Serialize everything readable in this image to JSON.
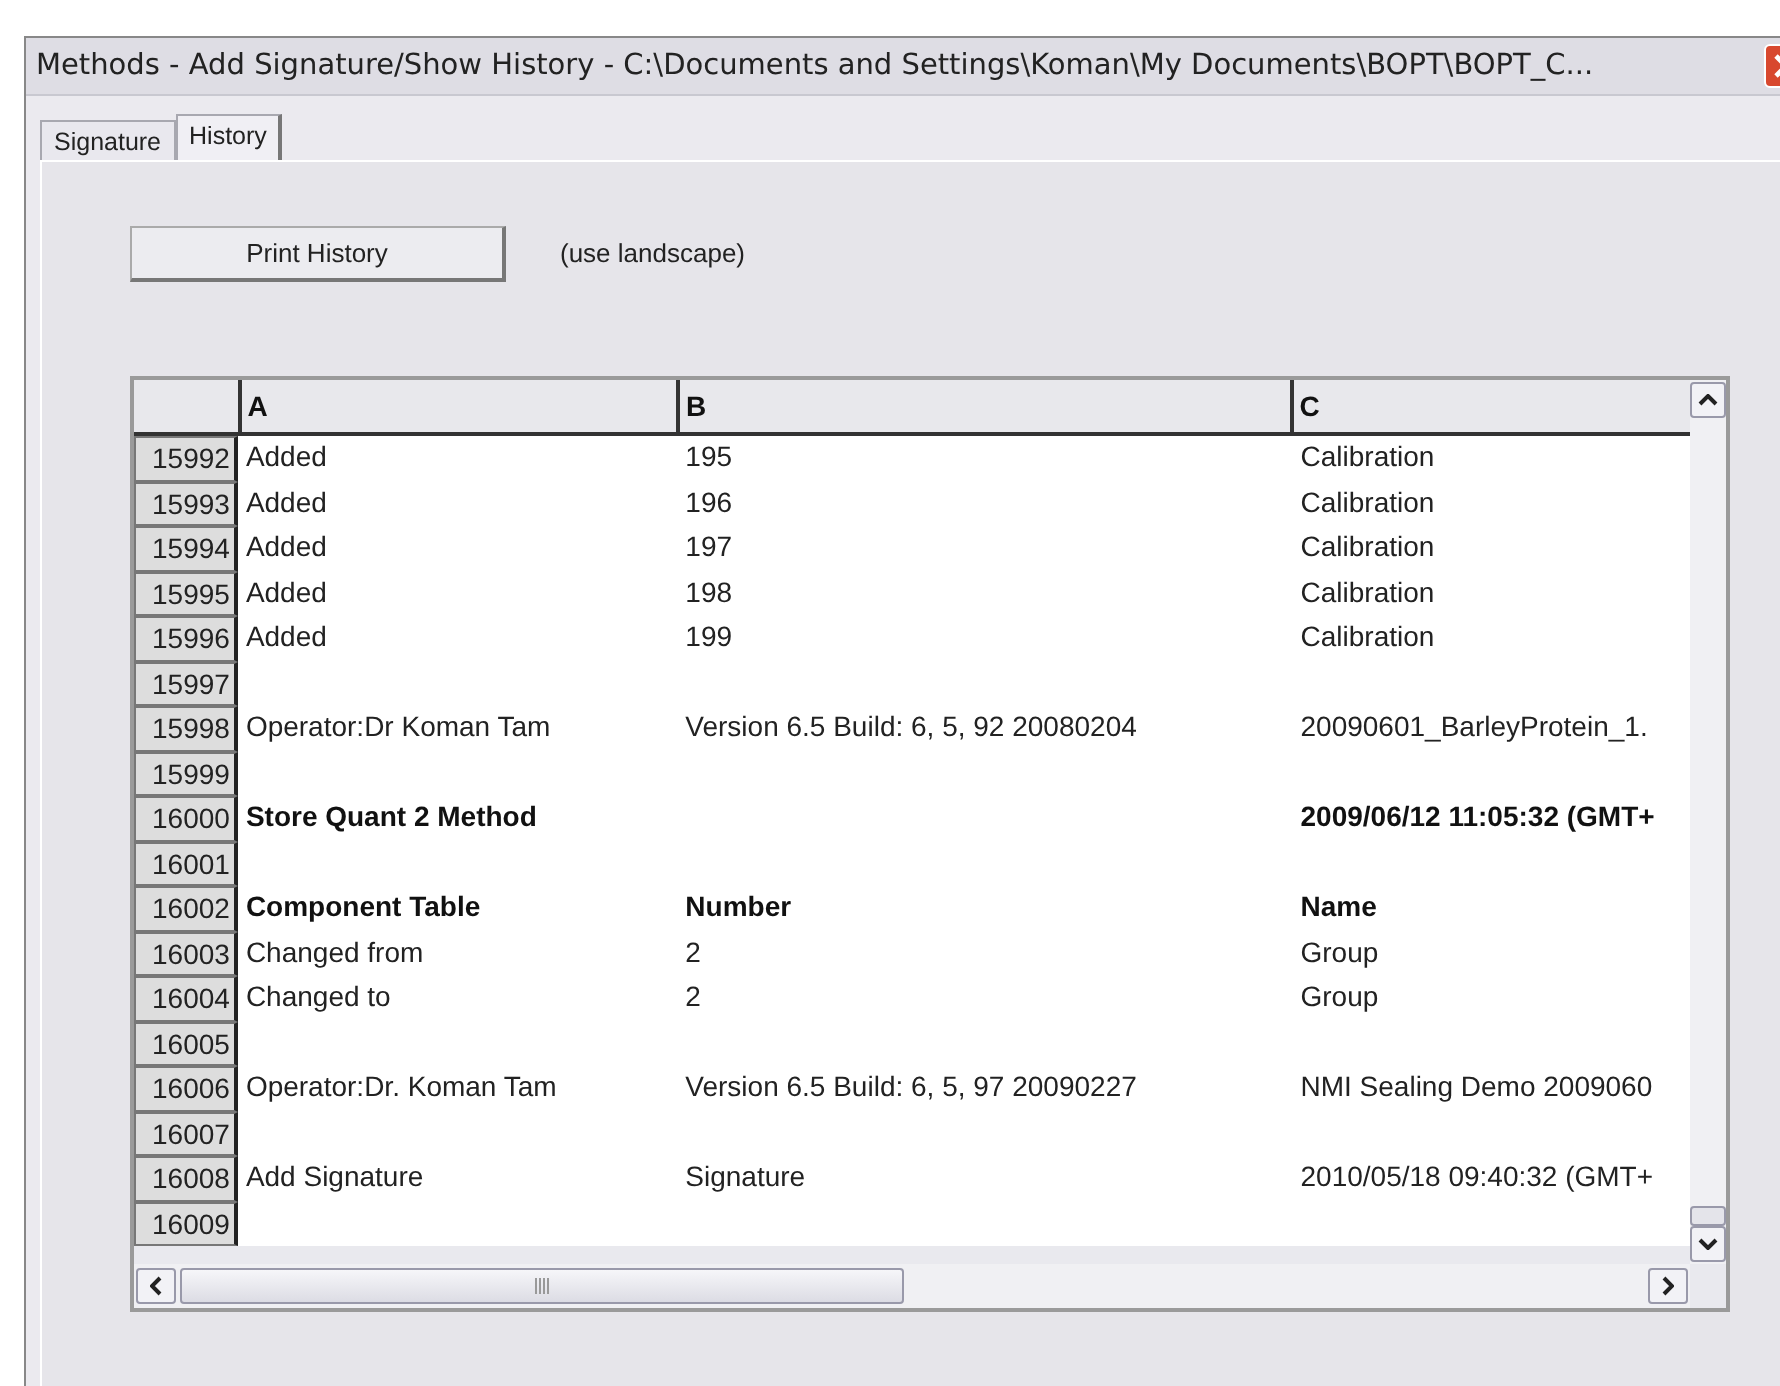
{
  "window": {
    "title": "Methods - Add Signature/Show History   -   C:\\Documents and Settings\\Koman\\My Documents\\BOPT\\BOPT_C..."
  },
  "tabs": [
    {
      "label": "Signature",
      "selected": false
    },
    {
      "label": "History",
      "selected": true
    }
  ],
  "print_button": "Print History",
  "print_note": "(use landscape)",
  "table": {
    "columns": [
      "A",
      "B",
      "C"
    ],
    "rows": [
      {
        "number": "15992",
        "cells": [
          "Added",
          "195",
          "Calibration"
        ],
        "bold": false
      },
      {
        "number": "15993",
        "cells": [
          "Added",
          "196",
          "Calibration"
        ],
        "bold": false
      },
      {
        "number": "15994",
        "cells": [
          "Added",
          "197",
          "Calibration"
        ],
        "bold": false
      },
      {
        "number": "15995",
        "cells": [
          "Added",
          "198",
          "Calibration"
        ],
        "bold": false
      },
      {
        "number": "15996",
        "cells": [
          "Added",
          "199",
          "Calibration"
        ],
        "bold": false
      },
      {
        "number": "15997",
        "cells": []
      },
      {
        "number": "15998",
        "cells": [
          "Operator:Dr Koman Tam",
          "Version 6.5 Build: 6, 5, 92 20080204",
          "20090601_BarleyProtein_1."
        ],
        "bold": false
      },
      {
        "number": "15999",
        "cells": []
      },
      {
        "number": "16000",
        "cells": [
          "Store Quant 2 Method",
          "",
          "2009/06/12 11:05:32 (GMT+"
        ],
        "bold": true
      },
      {
        "number": "16001",
        "cells": []
      },
      {
        "number": "16002",
        "cells": [
          "Component Table",
          "Number",
          "Name"
        ],
        "bold": true
      },
      {
        "number": "16003",
        "cells": [
          "Changed from",
          "2",
          "Group"
        ],
        "bold": false
      },
      {
        "number": "16004",
        "cells": [
          "Changed to",
          "2",
          "Group"
        ],
        "bold": false
      },
      {
        "number": "16005",
        "cells": []
      },
      {
        "number": "16006",
        "cells": [
          "Operator:Dr. Koman Tam",
          "Version 6.5 Build: 6, 5, 97 20090227",
          "NMI Sealing Demo 2009060"
        ],
        "bold": false
      },
      {
        "number": "16007",
        "cells": []
      },
      {
        "number": "16008",
        "cells": [
          "Add Signature",
          "Signature",
          "2010/05/18 09:40:32 (GMT+"
        ],
        "bold": false
      },
      {
        "number": "16009",
        "cells": []
      }
    ]
  }
}
